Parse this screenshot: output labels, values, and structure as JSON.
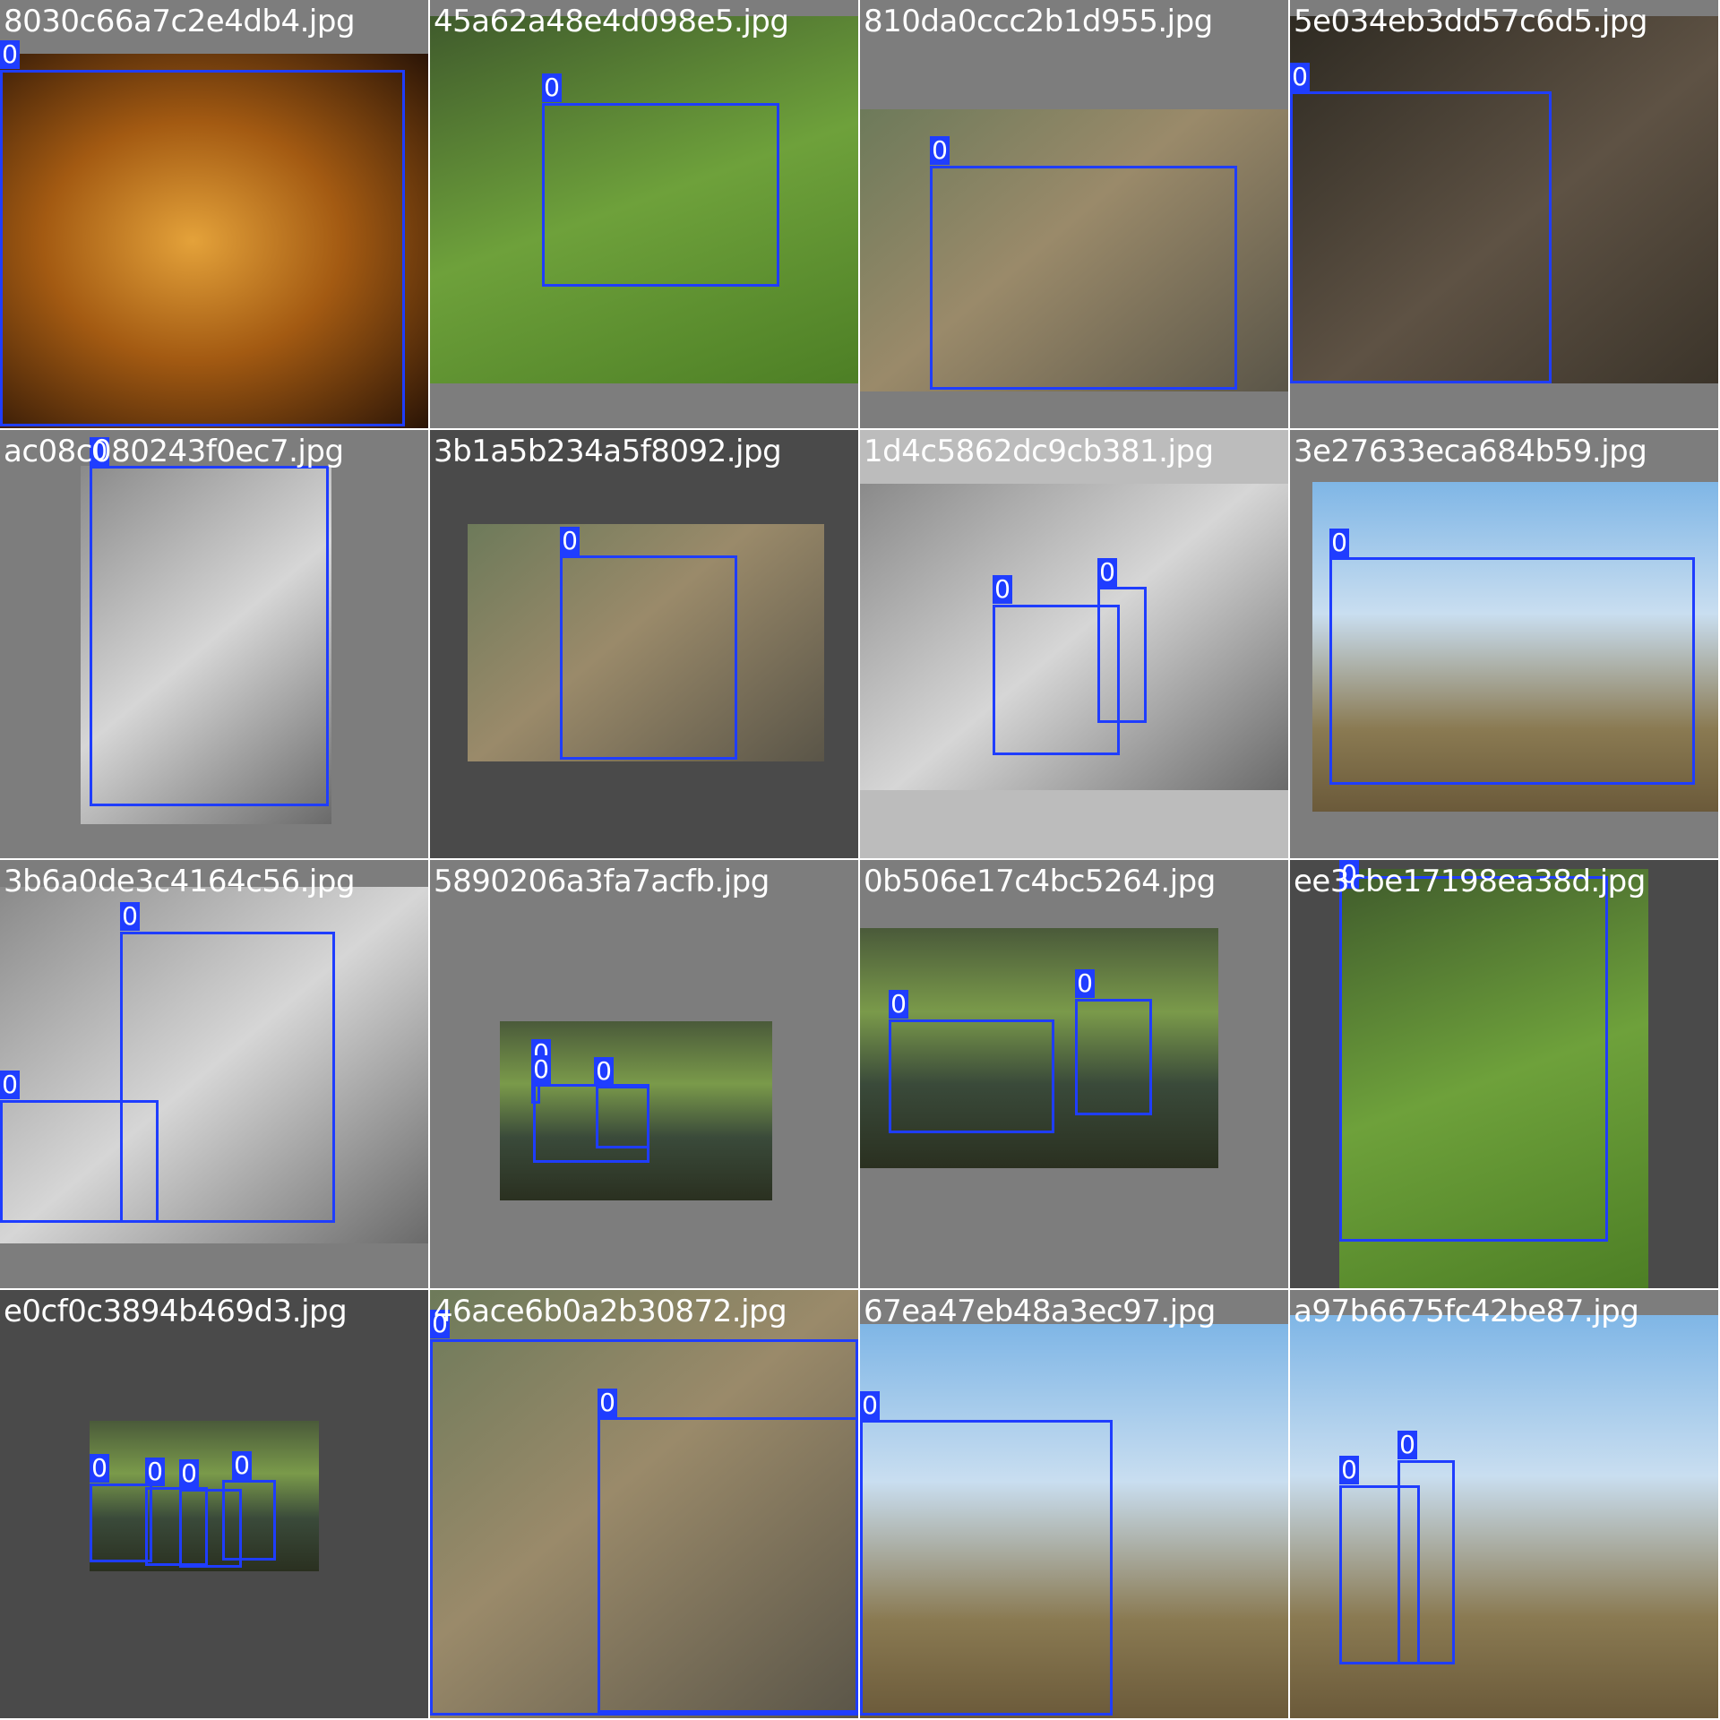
{
  "mosaic": {
    "tiles": [
      {
        "filename": "8030c66a7c2e4db4.jpg",
        "boxes": [
          {
            "label": "0"
          }
        ]
      },
      {
        "filename": "45a62a48e4d098e5.jpg",
        "boxes": [
          {
            "label": "0"
          }
        ]
      },
      {
        "filename": "810da0ccc2b1d955.jpg",
        "boxes": [
          {
            "label": "0"
          }
        ]
      },
      {
        "filename": "5e034eb3dd57c6d5.jpg",
        "boxes": [
          {
            "label": "0"
          }
        ]
      },
      {
        "filename": "ac08c080243f0ec7.jpg",
        "boxes": [
          {
            "label": "0"
          }
        ]
      },
      {
        "filename": "3b1a5b234a5f8092.jpg",
        "boxes": [
          {
            "label": "0"
          }
        ]
      },
      {
        "filename": "1d4c5862dc9cb381.jpg",
        "boxes": [
          {
            "label": "0"
          },
          {
            "label": "0"
          }
        ]
      },
      {
        "filename": "3e27633eca684b59.jpg",
        "boxes": [
          {
            "label": "0"
          }
        ]
      },
      {
        "filename": "3b6a0de3c4164c56.jpg",
        "boxes": [
          {
            "label": "0"
          },
          {
            "label": "0"
          }
        ]
      },
      {
        "filename": "5890206a3fa7acfb.jpg",
        "boxes": [
          {
            "label": "0"
          },
          {
            "label": "0"
          },
          {
            "label": "0"
          }
        ]
      },
      {
        "filename": "0b506e17c4bc5264.jpg",
        "boxes": [
          {
            "label": "0"
          },
          {
            "label": "0"
          }
        ]
      },
      {
        "filename": "ee3cbe17198ea38d.jpg",
        "boxes": [
          {
            "label": "0"
          }
        ]
      },
      {
        "filename": "e0cf0c3894b469d3.jpg",
        "boxes": [
          {
            "label": "0"
          },
          {
            "label": "0"
          },
          {
            "label": "0"
          },
          {
            "label": "0"
          }
        ]
      },
      {
        "filename": "46ace6b0a2b30872.jpg",
        "boxes": [
          {
            "label": "0"
          },
          {
            "label": "0"
          }
        ]
      },
      {
        "filename": "67ea47eb48a3ec97.jpg",
        "boxes": [
          {
            "label": "0"
          }
        ]
      },
      {
        "filename": "a97b6675fc42be87.jpg",
        "boxes": [
          {
            "label": "0"
          },
          {
            "label": "0"
          }
        ]
      }
    ],
    "colors": {
      "box": "#1f3dff",
      "label_bg": "#1f3dff",
      "label_text": "#ffffff",
      "filename_text": "#ffffff",
      "tile_bg": "#7d7d7d"
    }
  }
}
